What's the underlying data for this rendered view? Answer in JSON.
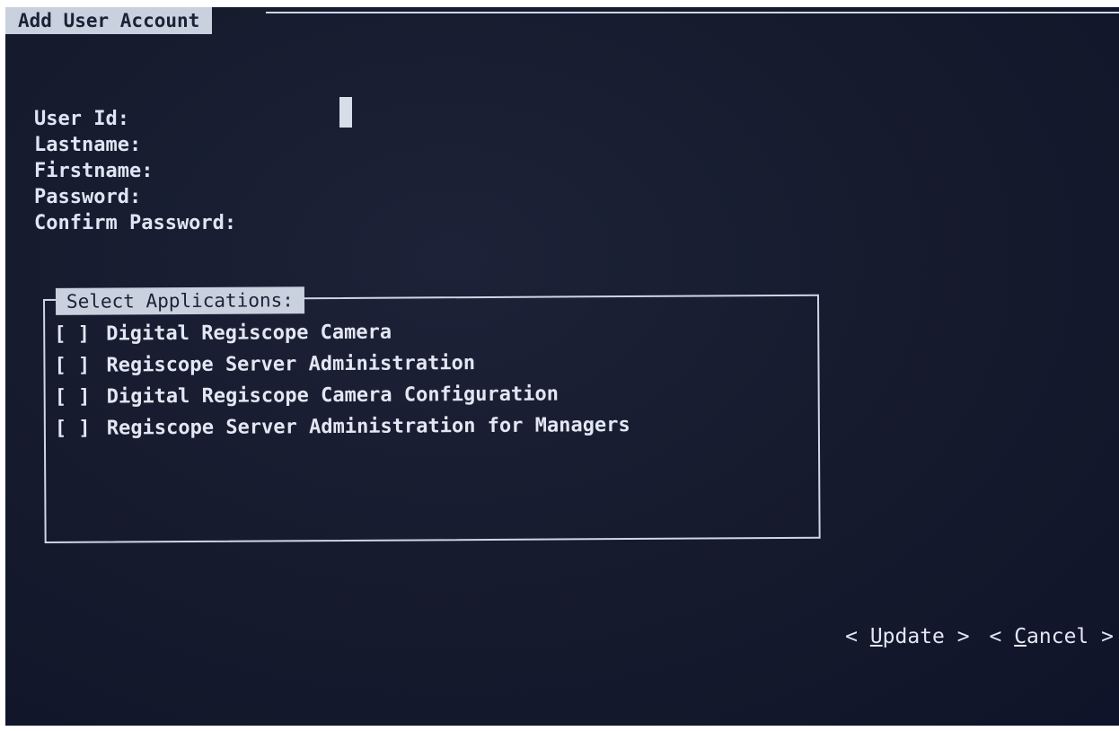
{
  "window": {
    "title": "Add User Account"
  },
  "form": {
    "fields": [
      {
        "label": "User Id:"
      },
      {
        "label": "Lastname:"
      },
      {
        "label": "Firstname:"
      },
      {
        "label": "Password:"
      },
      {
        "label": "Confirm Password:"
      }
    ]
  },
  "applications": {
    "title": "Select Applications:",
    "items": [
      {
        "checkbox": "[ ]",
        "label": "Digital Regiscope Camera"
      },
      {
        "checkbox": "[ ]",
        "label": "Regiscope Server Administration"
      },
      {
        "checkbox": "[ ]",
        "label": "Digital Regiscope Camera Configuration"
      },
      {
        "checkbox": "[ ]",
        "label": "Regiscope Server Administration for Managers"
      }
    ]
  },
  "buttons": {
    "update": {
      "left": "< ",
      "hotkey": "U",
      "rest": "pdate",
      "right": " >"
    },
    "cancel": {
      "left": "< ",
      "hotkey": "C",
      "rest": "ancel",
      "right": " >"
    }
  },
  "colors": {
    "background": "#151a2c",
    "tab": "#c9d0de",
    "text": "#dfe5f2"
  }
}
